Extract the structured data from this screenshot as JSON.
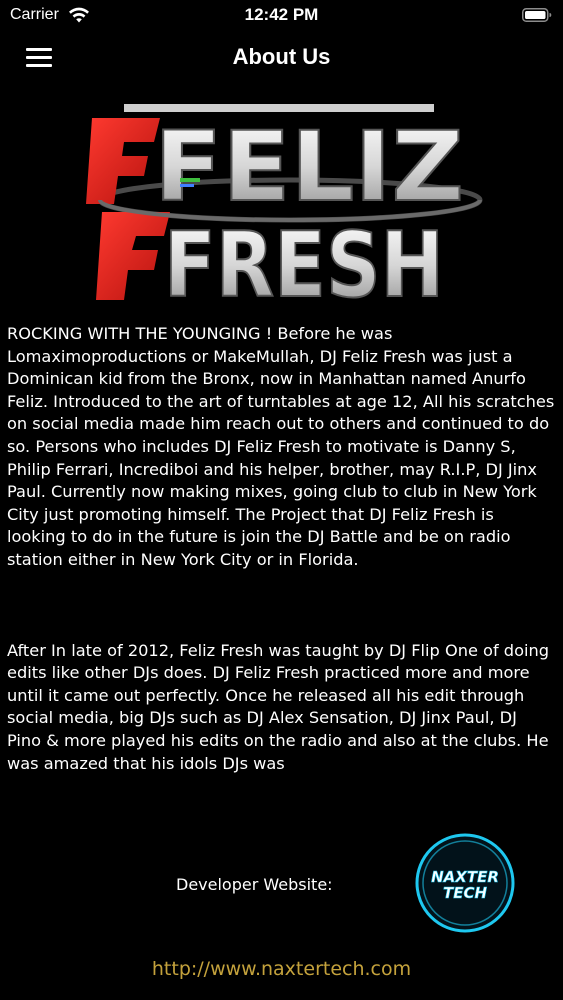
{
  "status_bar": {
    "carrier": "Carrier",
    "time": "12:42 PM",
    "wifi_icon": "wifi-icon",
    "battery_icon": "battery-icon"
  },
  "nav": {
    "title": "About Us",
    "menu_icon": "hamburger-menu-icon"
  },
  "logo": {
    "line1": "FELIZ",
    "line2": "FRESH",
    "colors": {
      "accent": "#e0201c",
      "chrome": "#e8e8e8"
    }
  },
  "about": {
    "paragraph1": "ROCKING WITH THE YOUNGING ! Before he was Lomaximoproductions or MakeMullah, DJ Feliz Fresh was just a Dominican kid from the Bronx, now in Manhattan named Anurfo Feliz. Introduced to the art of turntables at age 12, All his scratches on social media made him reach out to others and continued to do so. Persons who includes DJ Feliz Fresh to motivate is Danny S, Philip Ferrari, Incrediboi and his helper, brother, may R.I.P, DJ Jinx Paul. Currently now making mixes, going club to club in New York City just promoting himself. The Project that DJ Feliz Fresh is looking to do in the future is join the DJ Battle and be on radio station either in New York City or in Florida.",
    "paragraph2": "After In late of 2012, Feliz Fresh was taught by DJ Flip One of doing edits like other DJs does. DJ Feliz Fresh practiced more and more until it came out perfectly. Once he released all his edit through social media, big DJs such as DJ Alex Sensation, DJ Jinx Paul, DJ Pino & more played his edits on the radio and also at the clubs. He was amazed that his idols DJs was"
  },
  "developer": {
    "label": "Developer Website:",
    "logo_line1": "NAXTER",
    "logo_line2": "TECH",
    "url": "http://www.naxtertech.com",
    "link_color": "#c4a23c",
    "ring_color": "#1ec8f0"
  }
}
